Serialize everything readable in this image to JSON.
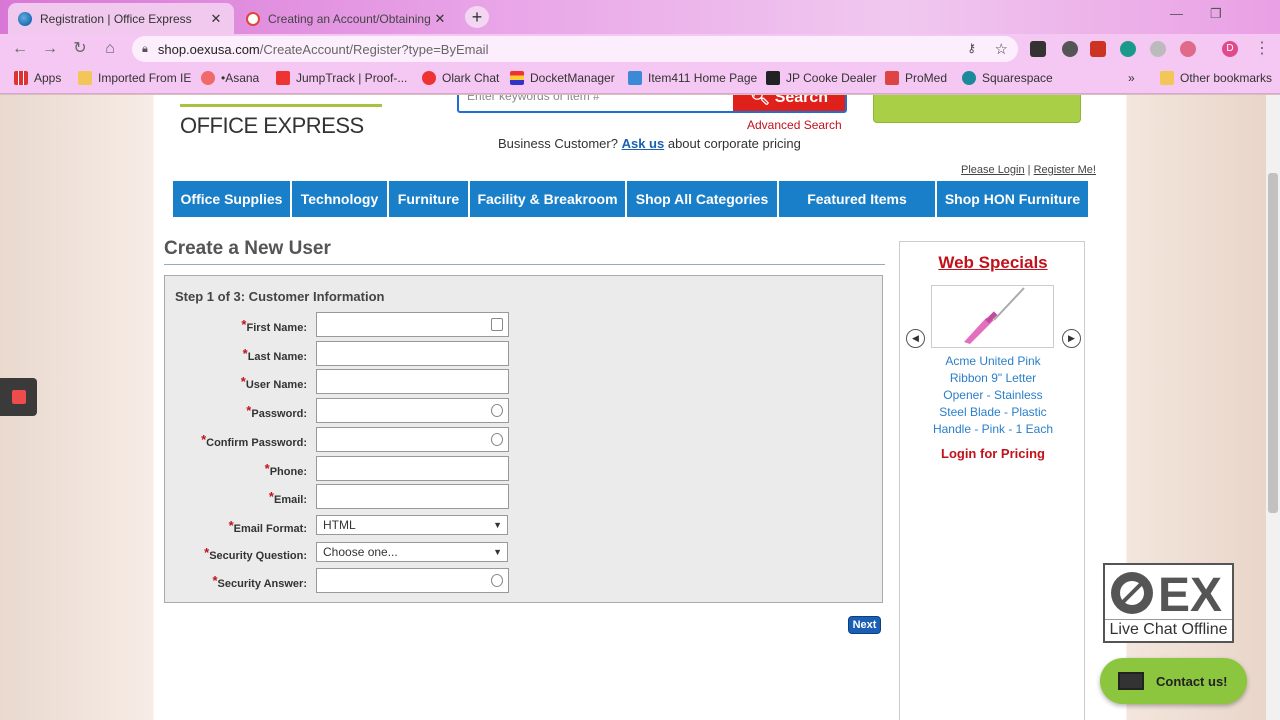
{
  "browser": {
    "tabs": [
      {
        "title": "Registration | Office Express",
        "close": "✕",
        "active": true
      },
      {
        "title": "Creating an Account/Obtaining a",
        "close": "✕",
        "active": false
      }
    ],
    "new_tab": "+",
    "address": {
      "host": "shop.oexusa.com",
      "path": "/CreateAccount/Register?type=ByEmail"
    },
    "profile_initial": "D",
    "bookmarks": [
      {
        "label": "Apps",
        "icon": "apps-grid-icon"
      },
      {
        "label": "Imported From IE",
        "icon": "folder-icon"
      },
      {
        "label": "•Asana",
        "icon": "asana-icon"
      },
      {
        "label": "JumpTrack | Proof-...",
        "icon": "jumptrack-icon"
      },
      {
        "label": "Olark Chat",
        "icon": "olark-icon"
      },
      {
        "label": "DocketManager",
        "icon": "docketmanager-icon"
      },
      {
        "label": "Item411 Home Page",
        "icon": "item411-icon"
      },
      {
        "label": "JP Cooke Dealer",
        "icon": "jpcooke-icon"
      },
      {
        "label": "ProMed",
        "icon": "promed-icon"
      },
      {
        "label": "Squarespace",
        "icon": "squarespace-icon"
      },
      {
        "label": "»",
        "icon": "overflow-icon"
      },
      {
        "label": "Other bookmarks",
        "icon": "folder-icon"
      }
    ]
  },
  "header": {
    "logo": "OFFICE EXPRESS",
    "search_placeholder": "Enter keywords or item #",
    "search_button": "Search",
    "advanced_search": "Advanced Search",
    "business_prefix": "Business Customer?",
    "business_link": "Ask us",
    "business_suffix": "about corporate pricing",
    "login_link": "Please Login",
    "login_sep": "|",
    "register_link": "Register Me!"
  },
  "nav": [
    {
      "label": "Office Supplies"
    },
    {
      "label": "Technology"
    },
    {
      "label": "Furniture"
    },
    {
      "label": "Facility & Breakroom"
    },
    {
      "label": "Shop All Categories"
    },
    {
      "label": "Featured Items"
    },
    {
      "label": "Shop HON Furniture"
    }
  ],
  "form": {
    "title": "Create a New User",
    "step": "Step 1 of 3: Customer Information",
    "required_mark": "*",
    "fields": [
      {
        "label": "First Name:",
        "value": ""
      },
      {
        "label": "Last Name:",
        "value": ""
      },
      {
        "label": "User Name:",
        "value": ""
      },
      {
        "label": "Password:",
        "value": ""
      },
      {
        "label": "Confirm Password:",
        "value": ""
      },
      {
        "label": "Phone:",
        "value": ""
      },
      {
        "label": "Email:",
        "value": ""
      },
      {
        "label": "Email Format:",
        "value": "HTML"
      },
      {
        "label": "Security Question:",
        "value": "Choose one..."
      },
      {
        "label": "Security Answer:",
        "value": ""
      }
    ],
    "next_button": "Next"
  },
  "specials": {
    "title": "Web Specials",
    "product_lines": [
      "Acme United Pink",
      "Ribbon 9\" Letter",
      "Opener - Stainless",
      "Steel Blade - Plastic",
      "Handle - Pink - 1 Each"
    ],
    "login_price": "Login for Pricing",
    "prev_icon": "◀",
    "next_icon": "▶"
  },
  "chat": {
    "badge_logo": "EX",
    "status": "Live Chat Offline",
    "contact_label": "Contact us!"
  },
  "colors": {
    "nav_blue": "#1a7fc9",
    "accent_red": "#c1121b",
    "chat_green": "#8cc63f"
  }
}
